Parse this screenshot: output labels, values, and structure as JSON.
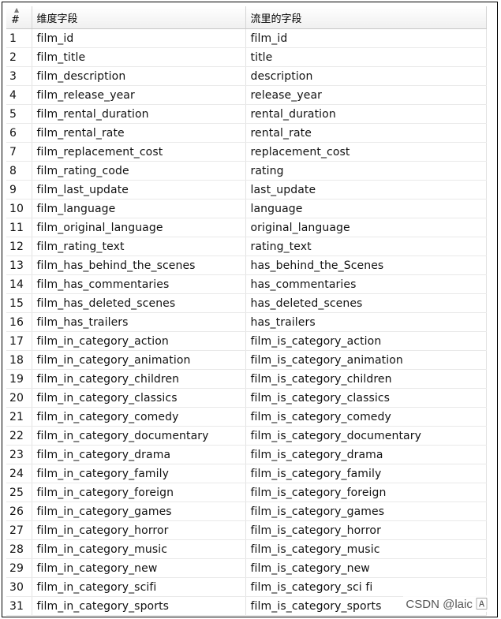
{
  "table": {
    "headers": {
      "num": "#",
      "dimension_field": "维度字段",
      "stream_field": "流里的字段"
    },
    "rows": [
      {
        "n": "1",
        "a": "film_id",
        "b": "film_id"
      },
      {
        "n": "2",
        "a": "film_title",
        "b": "title"
      },
      {
        "n": "3",
        "a": "film_description",
        "b": "description"
      },
      {
        "n": "4",
        "a": "film_release_year",
        "b": "release_year"
      },
      {
        "n": "5",
        "a": "film_rental_duration",
        "b": "rental_duration"
      },
      {
        "n": "6",
        "a": "film_rental_rate",
        "b": "rental_rate"
      },
      {
        "n": "7",
        "a": "film_replacement_cost",
        "b": "replacement_cost"
      },
      {
        "n": "8",
        "a": "film_rating_code",
        "b": "rating"
      },
      {
        "n": "9",
        "a": "film_last_update",
        "b": "last_update"
      },
      {
        "n": "10",
        "a": "film_language",
        "b": "language"
      },
      {
        "n": "11",
        "a": "film_original_language",
        "b": "original_language"
      },
      {
        "n": "12",
        "a": "film_rating_text",
        "b": "rating_text"
      },
      {
        "n": "13",
        "a": "film_has_behind_the_scenes",
        "b": "has_behind_the_Scenes"
      },
      {
        "n": "14",
        "a": "film_has_commentaries",
        "b": "has_commentaries"
      },
      {
        "n": "15",
        "a": "film_has_deleted_scenes",
        "b": "has_deleted_scenes"
      },
      {
        "n": "16",
        "a": "film_has_trailers",
        "b": "has_trailers"
      },
      {
        "n": "17",
        "a": "film_in_category_action",
        "b": "film_is_category_action"
      },
      {
        "n": "18",
        "a": "film_in_category_animation",
        "b": "film_is_category_animation"
      },
      {
        "n": "19",
        "a": "film_in_category_children",
        "b": "film_is_category_children"
      },
      {
        "n": "20",
        "a": "film_in_category_classics",
        "b": "film_is_category_classics"
      },
      {
        "n": "21",
        "a": "film_in_category_comedy",
        "b": "film_is_category_comedy"
      },
      {
        "n": "22",
        "a": "film_in_category_documentary",
        "b": "film_is_category_documentary"
      },
      {
        "n": "23",
        "a": "film_in_category_drama",
        "b": "film_is_category_drama"
      },
      {
        "n": "24",
        "a": "film_in_category_family",
        "b": "film_is_category_family"
      },
      {
        "n": "25",
        "a": "film_in_category_foreign",
        "b": "film_is_category_foreign"
      },
      {
        "n": "26",
        "a": "film_in_category_games",
        "b": "film_is_category_games"
      },
      {
        "n": "27",
        "a": "film_in_category_horror",
        "b": "film_is_category_horror"
      },
      {
        "n": "28",
        "a": "film_in_category_music",
        "b": "film_is_category_music"
      },
      {
        "n": "29",
        "a": "film_in_category_new",
        "b": "film_is_category_new"
      },
      {
        "n": "30",
        "a": "film_in_category_scifi",
        "b": "film_is_category_sci fi"
      },
      {
        "n": "31",
        "a": "film_in_category_sports",
        "b": "film_is_category_sports"
      }
    ]
  },
  "watermark": "CSDN @laic 🄰",
  "icons": {
    "sort": "sort-arrow-icon"
  },
  "colors": {
    "border": "#000000",
    "header_bg": "#f0f0f0",
    "grid_line": "#e3e3e3"
  }
}
